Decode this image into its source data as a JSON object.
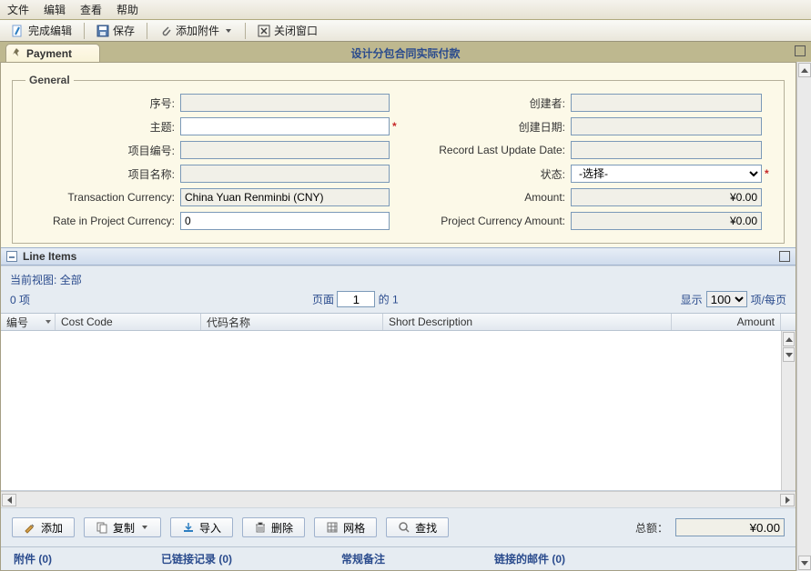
{
  "menubar": {
    "file": "文件",
    "edit": "编辑",
    "view": "查看",
    "help": "帮助"
  },
  "toolbar": {
    "finish_edit": "完成编辑",
    "save": "保存",
    "add_attachment": "添加附件",
    "close_window": "关闭窗口"
  },
  "tab": {
    "label": "Payment"
  },
  "title": "设计分包合同实际付款",
  "general": {
    "legend": "General",
    "labels": {
      "serial": "序号:",
      "subject": "主题:",
      "project_no": "项目编号:",
      "project_name": "项目名称:",
      "txn_currency": "Transaction Currency:",
      "rate": "Rate in Project Currency:",
      "creator": "创建者:",
      "created_date": "创建日期:",
      "last_update": "Record Last Update Date:",
      "status": "状态:",
      "amount": "Amount:",
      "proj_amount": "Project Currency Amount:"
    },
    "values": {
      "serial": "",
      "subject": "",
      "project_no": "",
      "project_name": "",
      "txn_currency": "China Yuan Renminbi (CNY)",
      "rate": "0",
      "creator": "",
      "created_date": "",
      "last_update": "",
      "status_selected": "-选择-",
      "amount": "¥0.00",
      "proj_amount": "¥0.00"
    }
  },
  "lineitems": {
    "header": "Line Items",
    "current_view_label": "当前视图:",
    "current_view_value": "全部",
    "items_count": "0 项",
    "page_label": "页面",
    "page_value": "1",
    "page_of": "的 1",
    "show_label": "显示",
    "show_value": "100",
    "per_page": "项/每页",
    "columns": {
      "no": "编号",
      "cost_code": "Cost Code",
      "code_name": "代码名称",
      "short_desc": "Short Description",
      "amount": "Amount"
    }
  },
  "buttons": {
    "add": "添加",
    "copy": "复制",
    "import": "导入",
    "delete": "删除",
    "grid": "网格",
    "find": "查找"
  },
  "totals": {
    "label": "总额：",
    "value": "¥0.00"
  },
  "footer": {
    "attachments": "附件 (0)",
    "linked_records": "已链接记录 (0)",
    "general_notes": "常规备注",
    "linked_mail": "链接的邮件 (0)"
  }
}
